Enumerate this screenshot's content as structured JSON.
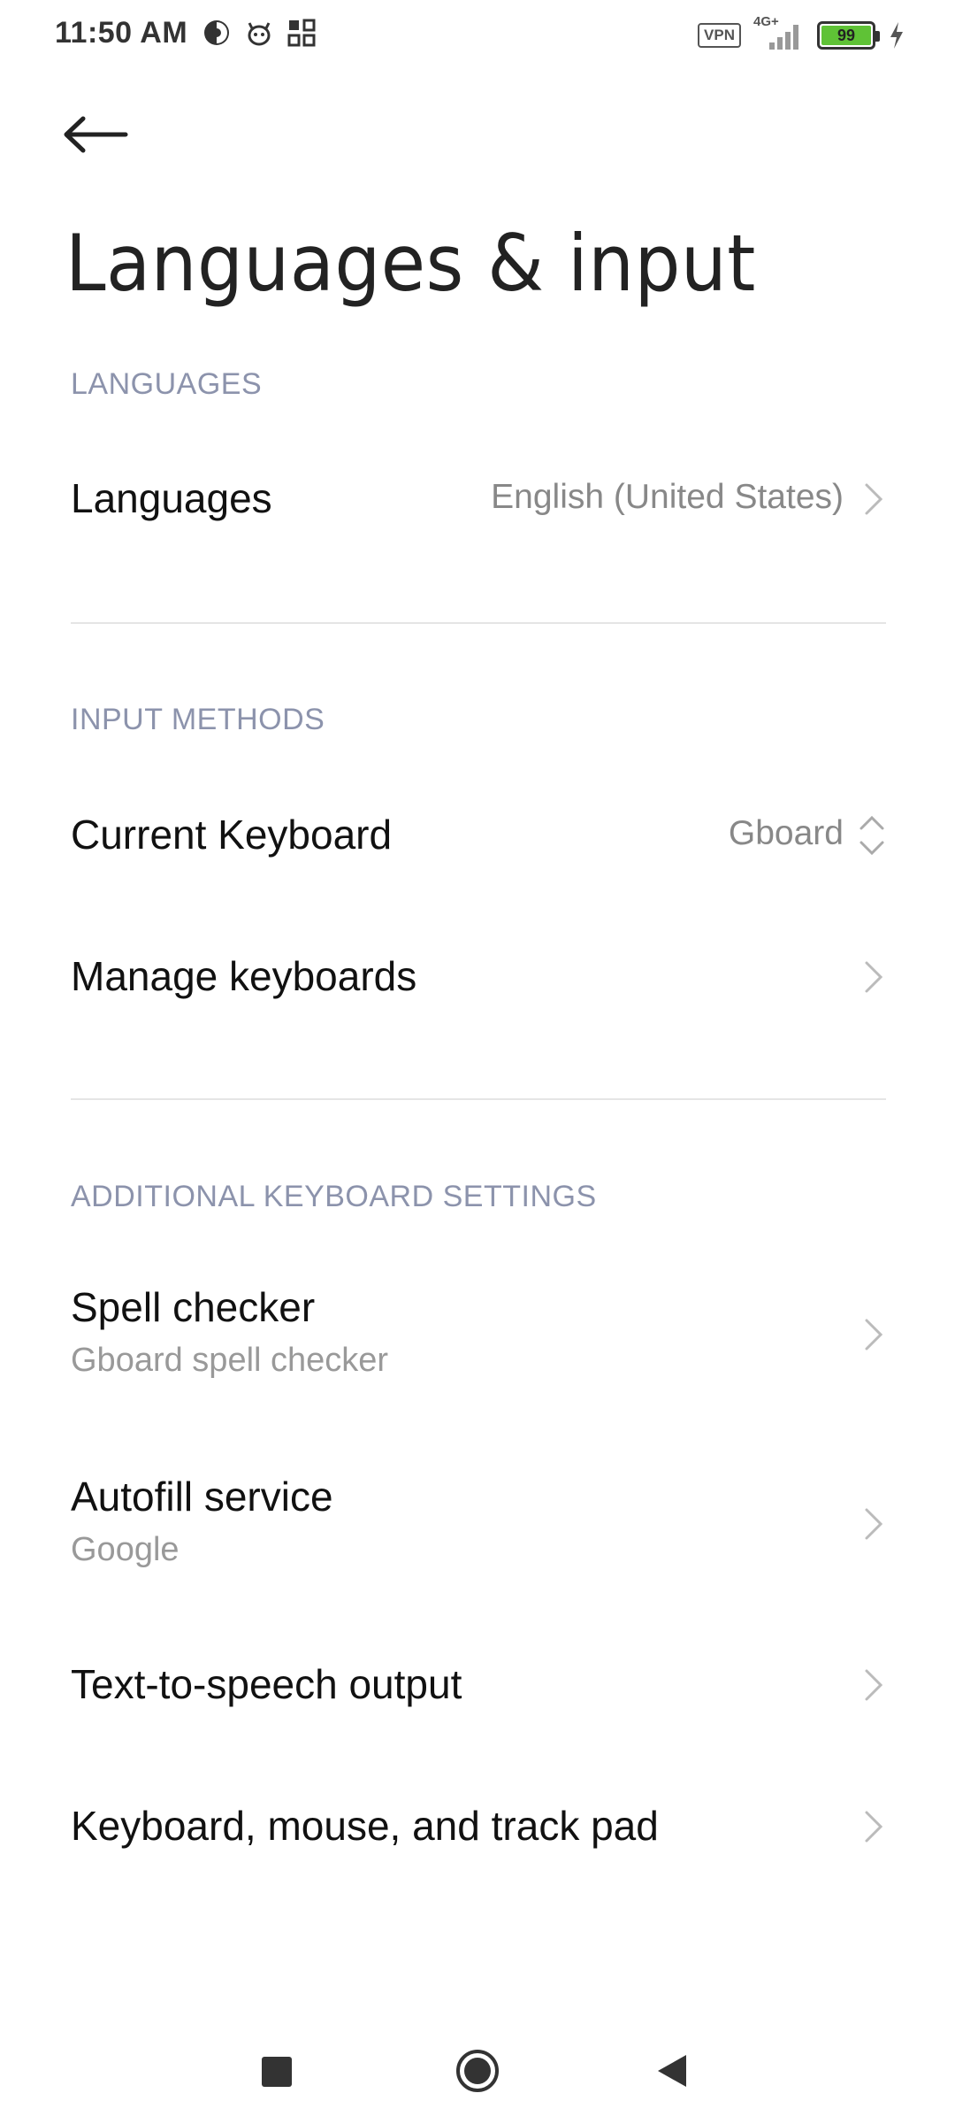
{
  "status_bar": {
    "time": "11:50 AM",
    "vpn_label": "VPN",
    "network_label": "4G+",
    "battery_level": "99",
    "icons": [
      "data-saver-icon",
      "cat-face-icon",
      "app-grid-icon",
      "signal-icon",
      "charging-bolt-icon"
    ],
    "battery_color": "#5fc236"
  },
  "header": {
    "back_icon": "arrow-left-icon",
    "title": "Languages & input"
  },
  "sections": {
    "languages": {
      "header": "LANGUAGES",
      "languages_row": {
        "title": "Languages",
        "value": "English (United States)"
      }
    },
    "input_methods": {
      "header": "INPUT METHODS",
      "current_keyboard": {
        "title": "Current Keyboard",
        "value": "Gboard"
      },
      "manage_keyboards": {
        "title": "Manage keyboards"
      }
    },
    "additional": {
      "header": "ADDITIONAL KEYBOARD SETTINGS",
      "spell_checker": {
        "title": "Spell checker",
        "subtitle": "Gboard spell checker"
      },
      "autofill": {
        "title": "Autofill service",
        "subtitle": "Google"
      },
      "tts": {
        "title": "Text-to-speech output"
      },
      "keyboard_mouse": {
        "title": "Keyboard, mouse, and track pad"
      }
    }
  },
  "nav_bar": {
    "icons": [
      "recents-square-icon",
      "home-circle-icon",
      "back-triangle-icon"
    ]
  },
  "colors": {
    "section_header": "#8c93ac",
    "value_text": "#888888",
    "divider": "#e5e5e5"
  }
}
